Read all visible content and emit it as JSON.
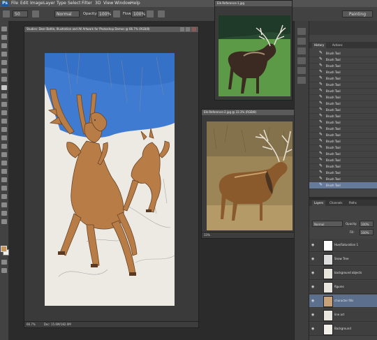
{
  "menu": {
    "logo": "Ps",
    "items": [
      "File",
      "Edit",
      "Image",
      "Layer",
      "Type",
      "Select",
      "Filter",
      "3D",
      "View",
      "Window",
      "Help"
    ]
  },
  "options": {
    "size": "50",
    "mode": "Normal",
    "opacity_label": "Opacity:",
    "opacity": "100%",
    "flow_label": "Flow:",
    "flow": "100%",
    "workspace": "Painting"
  },
  "main_doc": {
    "title": "Studies: Deer Battle, Illustration and All Artwork for Photoshop Demos @ 66.7% (RGB/8)",
    "zoom": "66.7%",
    "doc_size": "Doc: 15.6M/182.0M"
  },
  "ref1": {
    "title": "Elk-Reference-1.jpg"
  },
  "ref2": {
    "title": "Elk-Reference-2.jpg @ 33.3% (RGB/8)",
    "zoom": "33%"
  },
  "history": {
    "tabs": [
      "History",
      "Actions"
    ],
    "items": [
      "Brush Tool",
      "Brush Tool",
      "Brush Tool",
      "Brush Tool",
      "Brush Tool",
      "Brush Tool",
      "Brush Tool",
      "Brush Tool",
      "Brush Tool",
      "Brush Tool",
      "Brush Tool",
      "Brush Tool",
      "Brush Tool",
      "Brush Tool",
      "Brush Tool",
      "Brush Tool",
      "Brush Tool",
      "Brush Tool",
      "Brush Tool",
      "Brush Tool",
      "Brush Tool",
      "Brush Tool"
    ]
  },
  "layers": {
    "tabs": [
      "Layers",
      "Channels",
      "Paths"
    ],
    "blend_mode": "Normal",
    "opacity_label": "Opacity:",
    "opacity": "100%",
    "fill_label": "Fill:",
    "fill": "100%",
    "items": [
      "Hue/Saturation 1",
      "Snow Tree",
      "background objects",
      "figures",
      "character fills",
      "line art",
      "Background"
    ],
    "active_index": 4
  }
}
